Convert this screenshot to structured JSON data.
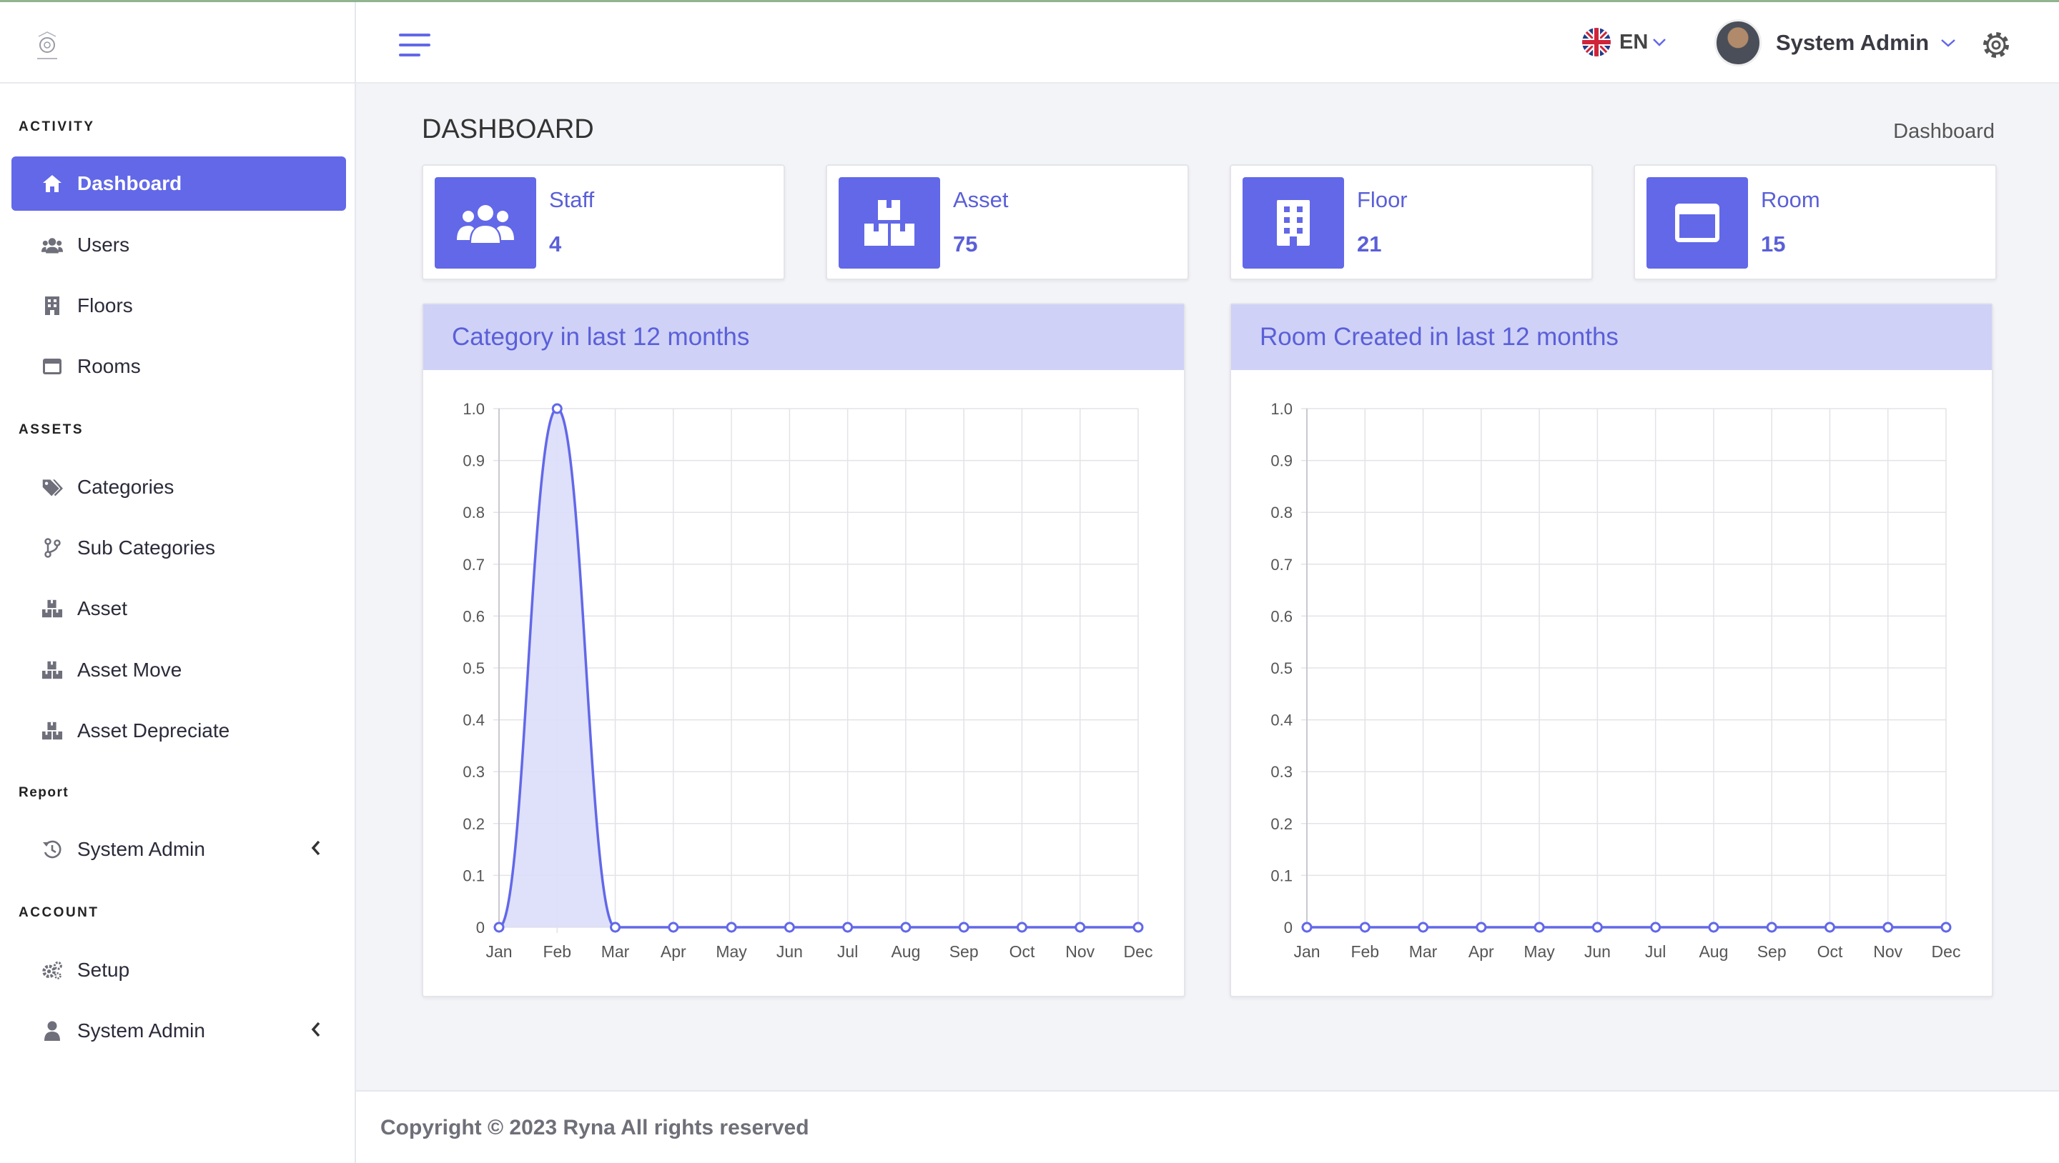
{
  "header": {
    "language": "EN",
    "user_name": "System Admin"
  },
  "sidebar": {
    "sections": {
      "activity": "ACTIVITY",
      "assets": "ASSETS",
      "report": "Report",
      "account": "ACCOUNT"
    },
    "items": [
      {
        "label": "Dashboard",
        "icon": "home-icon",
        "active": true
      },
      {
        "label": "Users",
        "icon": "users-icon"
      },
      {
        "label": "Floors",
        "icon": "building-icon"
      },
      {
        "label": "Rooms",
        "icon": "room-icon"
      },
      {
        "label": "Categories",
        "icon": "tags-icon"
      },
      {
        "label": "Sub Categories",
        "icon": "branch-icon"
      },
      {
        "label": "Asset",
        "icon": "boxes-icon"
      },
      {
        "label": "Asset Move",
        "icon": "boxes-icon"
      },
      {
        "label": "Asset Depreciate",
        "icon": "boxes-icon"
      },
      {
        "label": "System Admin",
        "icon": "history-icon"
      },
      {
        "label": "Setup",
        "icon": "cogs-icon"
      },
      {
        "label": "System Admin",
        "icon": "user-icon"
      }
    ]
  },
  "page": {
    "title": "DASHBOARD",
    "breadcrumb": "Dashboard"
  },
  "cards": [
    {
      "label": "Staff",
      "value": "4",
      "icon": "staff-icon"
    },
    {
      "label": "Asset",
      "value": "75",
      "icon": "asset-icon"
    },
    {
      "label": "Floor",
      "value": "21",
      "icon": "floor-icon"
    },
    {
      "label": "Room",
      "value": "15",
      "icon": "room-icon"
    }
  ],
  "colors": {
    "accent": "#6268e8",
    "panel_header": "#cfd1f7",
    "area_fill": "#dcddf9"
  },
  "chart_data": [
    {
      "type": "area",
      "title": "Category in last 12 months",
      "categories": [
        "Jan",
        "Feb",
        "Mar",
        "Apr",
        "May",
        "Jun",
        "Jul",
        "Aug",
        "Sep",
        "Oct",
        "Nov",
        "Dec"
      ],
      "values": [
        0,
        1,
        0,
        0,
        0,
        0,
        0,
        0,
        0,
        0,
        0,
        0
      ],
      "yticks": [
        "0",
        "0.1",
        "0.2",
        "0.3",
        "0.4",
        "0.5",
        "0.6",
        "0.7",
        "0.8",
        "0.9",
        "1.0"
      ],
      "ylim": [
        0,
        1
      ],
      "grid": true
    },
    {
      "type": "line",
      "title": "Room Created in last 12 months",
      "categories": [
        "Jan",
        "Feb",
        "Mar",
        "Apr",
        "May",
        "Jun",
        "Jul",
        "Aug",
        "Sep",
        "Oct",
        "Nov",
        "Dec"
      ],
      "values": [
        0,
        0,
        0,
        0,
        0,
        0,
        0,
        0,
        0,
        0,
        0,
        0
      ],
      "yticks": [
        "0",
        "0.1",
        "0.2",
        "0.3",
        "0.4",
        "0.5",
        "0.6",
        "0.7",
        "0.8",
        "0.9",
        "1.0"
      ],
      "ylim": [
        0,
        1
      ],
      "grid": true
    }
  ],
  "footer": {
    "copyright": "Copyright © 2023 Ryna All rights reserved"
  }
}
